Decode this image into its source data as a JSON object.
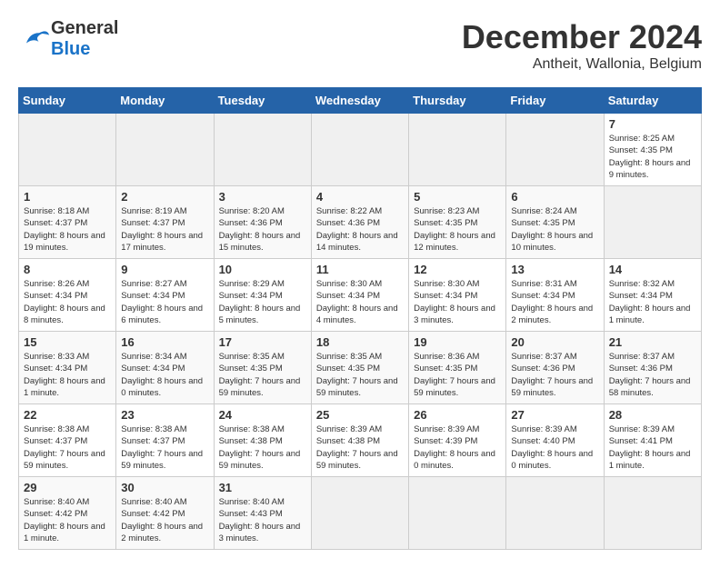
{
  "header": {
    "logo_general": "General",
    "logo_blue": "Blue",
    "title": "December 2024",
    "subtitle": "Antheit, Wallonia, Belgium"
  },
  "calendar": {
    "days_of_week": [
      "Sunday",
      "Monday",
      "Tuesday",
      "Wednesday",
      "Thursday",
      "Friday",
      "Saturday"
    ],
    "weeks": [
      [
        null,
        null,
        null,
        null,
        null,
        null,
        {
          "day": "7",
          "sunrise": "Sunrise: 8:25 AM",
          "sunset": "Sunset: 4:35 PM",
          "daylight": "Daylight: 8 hours and 9 minutes."
        }
      ],
      [
        {
          "day": "1",
          "sunrise": "Sunrise: 8:18 AM",
          "sunset": "Sunset: 4:37 PM",
          "daylight": "Daylight: 8 hours and 19 minutes."
        },
        {
          "day": "2",
          "sunrise": "Sunrise: 8:19 AM",
          "sunset": "Sunset: 4:37 PM",
          "daylight": "Daylight: 8 hours and 17 minutes."
        },
        {
          "day": "3",
          "sunrise": "Sunrise: 8:20 AM",
          "sunset": "Sunset: 4:36 PM",
          "daylight": "Daylight: 8 hours and 15 minutes."
        },
        {
          "day": "4",
          "sunrise": "Sunrise: 8:22 AM",
          "sunset": "Sunset: 4:36 PM",
          "daylight": "Daylight: 8 hours and 14 minutes."
        },
        {
          "day": "5",
          "sunrise": "Sunrise: 8:23 AM",
          "sunset": "Sunset: 4:35 PM",
          "daylight": "Daylight: 8 hours and 12 minutes."
        },
        {
          "day": "6",
          "sunrise": "Sunrise: 8:24 AM",
          "sunset": "Sunset: 4:35 PM",
          "daylight": "Daylight: 8 hours and 10 minutes."
        },
        null
      ],
      [
        {
          "day": "8",
          "sunrise": "Sunrise: 8:26 AM",
          "sunset": "Sunset: 4:34 PM",
          "daylight": "Daylight: 8 hours and 8 minutes."
        },
        {
          "day": "9",
          "sunrise": "Sunrise: 8:27 AM",
          "sunset": "Sunset: 4:34 PM",
          "daylight": "Daylight: 8 hours and 6 minutes."
        },
        {
          "day": "10",
          "sunrise": "Sunrise: 8:29 AM",
          "sunset": "Sunset: 4:34 PM",
          "daylight": "Daylight: 8 hours and 5 minutes."
        },
        {
          "day": "11",
          "sunrise": "Sunrise: 8:30 AM",
          "sunset": "Sunset: 4:34 PM",
          "daylight": "Daylight: 8 hours and 4 minutes."
        },
        {
          "day": "12",
          "sunrise": "Sunrise: 8:30 AM",
          "sunset": "Sunset: 4:34 PM",
          "daylight": "Daylight: 8 hours and 3 minutes."
        },
        {
          "day": "13",
          "sunrise": "Sunrise: 8:31 AM",
          "sunset": "Sunset: 4:34 PM",
          "daylight": "Daylight: 8 hours and 2 minutes."
        },
        {
          "day": "14",
          "sunrise": "Sunrise: 8:32 AM",
          "sunset": "Sunset: 4:34 PM",
          "daylight": "Daylight: 8 hours and 1 minute."
        }
      ],
      [
        {
          "day": "15",
          "sunrise": "Sunrise: 8:33 AM",
          "sunset": "Sunset: 4:34 PM",
          "daylight": "Daylight: 8 hours and 1 minute."
        },
        {
          "day": "16",
          "sunrise": "Sunrise: 8:34 AM",
          "sunset": "Sunset: 4:34 PM",
          "daylight": "Daylight: 8 hours and 0 minutes."
        },
        {
          "day": "17",
          "sunrise": "Sunrise: 8:35 AM",
          "sunset": "Sunset: 4:35 PM",
          "daylight": "Daylight: 7 hours and 59 minutes."
        },
        {
          "day": "18",
          "sunrise": "Sunrise: 8:35 AM",
          "sunset": "Sunset: 4:35 PM",
          "daylight": "Daylight: 7 hours and 59 minutes."
        },
        {
          "day": "19",
          "sunrise": "Sunrise: 8:36 AM",
          "sunset": "Sunset: 4:35 PM",
          "daylight": "Daylight: 7 hours and 59 minutes."
        },
        {
          "day": "20",
          "sunrise": "Sunrise: 8:37 AM",
          "sunset": "Sunset: 4:36 PM",
          "daylight": "Daylight: 7 hours and 59 minutes."
        },
        {
          "day": "21",
          "sunrise": "Sunrise: 8:37 AM",
          "sunset": "Sunset: 4:36 PM",
          "daylight": "Daylight: 7 hours and 58 minutes."
        }
      ],
      [
        {
          "day": "22",
          "sunrise": "Sunrise: 8:38 AM",
          "sunset": "Sunset: 4:37 PM",
          "daylight": "Daylight: 7 hours and 59 minutes."
        },
        {
          "day": "23",
          "sunrise": "Sunrise: 8:38 AM",
          "sunset": "Sunset: 4:37 PM",
          "daylight": "Daylight: 7 hours and 59 minutes."
        },
        {
          "day": "24",
          "sunrise": "Sunrise: 8:38 AM",
          "sunset": "Sunset: 4:38 PM",
          "daylight": "Daylight: 7 hours and 59 minutes."
        },
        {
          "day": "25",
          "sunrise": "Sunrise: 8:39 AM",
          "sunset": "Sunset: 4:38 PM",
          "daylight": "Daylight: 7 hours and 59 minutes."
        },
        {
          "day": "26",
          "sunrise": "Sunrise: 8:39 AM",
          "sunset": "Sunset: 4:39 PM",
          "daylight": "Daylight: 8 hours and 0 minutes."
        },
        {
          "day": "27",
          "sunrise": "Sunrise: 8:39 AM",
          "sunset": "Sunset: 4:40 PM",
          "daylight": "Daylight: 8 hours and 0 minutes."
        },
        {
          "day": "28",
          "sunrise": "Sunrise: 8:39 AM",
          "sunset": "Sunset: 4:41 PM",
          "daylight": "Daylight: 8 hours and 1 minute."
        }
      ],
      [
        {
          "day": "29",
          "sunrise": "Sunrise: 8:40 AM",
          "sunset": "Sunset: 4:42 PM",
          "daylight": "Daylight: 8 hours and 1 minute."
        },
        {
          "day": "30",
          "sunrise": "Sunrise: 8:40 AM",
          "sunset": "Sunset: 4:42 PM",
          "daylight": "Daylight: 8 hours and 2 minutes."
        },
        {
          "day": "31",
          "sunrise": "Sunrise: 8:40 AM",
          "sunset": "Sunset: 4:43 PM",
          "daylight": "Daylight: 8 hours and 3 minutes."
        },
        null,
        null,
        null,
        null
      ]
    ]
  }
}
